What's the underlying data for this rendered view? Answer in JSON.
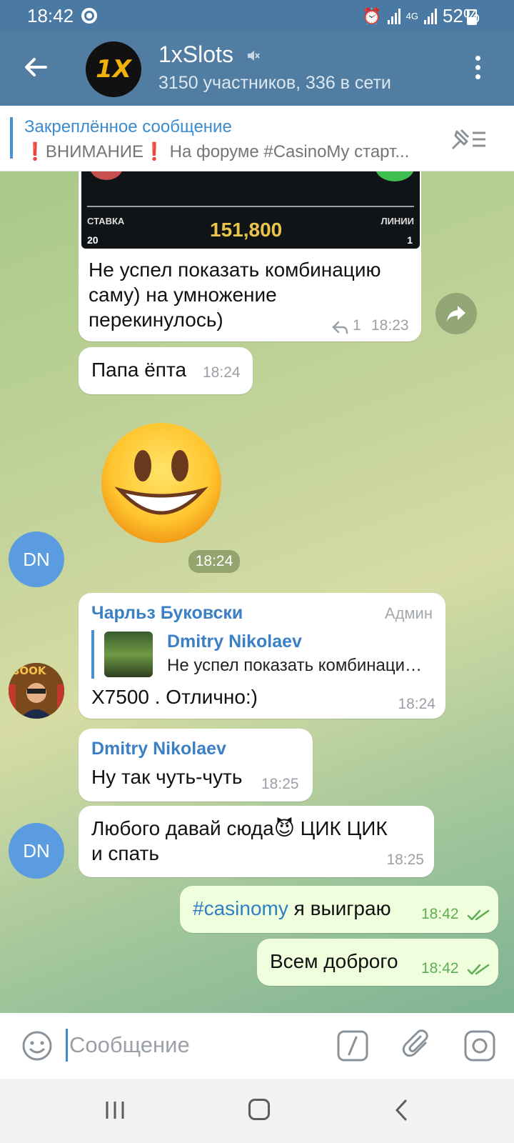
{
  "status_bar": {
    "time": "18:42",
    "network": "4G",
    "battery": "52%"
  },
  "header": {
    "title": "1xSlots",
    "subtitle": "3150 участников, 336 в сети",
    "logo_text": "1X"
  },
  "pinned": {
    "title": "Закреплённое сообщение",
    "text": "❗ВНИМАНИЕ❗ На форуме #CasinoMy старт..."
  },
  "messages": {
    "m1": {
      "image": {
        "stake_label": "СТАВКА",
        "stake_value": "20",
        "win": "151,800",
        "lines_label": "ЛИНИИ",
        "lines_value": "1"
      },
      "text_line1": "Не успел показать комбинацию",
      "text_line2": "саму) на умножение",
      "text_line3": "перекинулось)",
      "replies": "1",
      "time": "18:23"
    },
    "m2": {
      "text": "Папа ёпта",
      "time": "18:24"
    },
    "m3": {
      "emoji": "😃",
      "time": "18:24",
      "avatar": "DN"
    },
    "m4": {
      "sender": "Чарльз Буковски",
      "badge": "Админ",
      "reply_name": "Dmitry Nikolaev",
      "reply_text": "Не успел показать комбинацию саму) на умножение перекинулось)",
      "text": "Х7500 . Отлично:)",
      "time": "18:24"
    },
    "m5": {
      "sender": "Dmitry Nikolaev",
      "text": "Ну так чуть-чуть",
      "time": "18:25"
    },
    "m6": {
      "text_line1": "Любого давай сюда😈 ЦИК ЦИК",
      "text_line2": "и спать",
      "time": "18:25",
      "avatar": "DN"
    },
    "m7": {
      "hashtag": "#casinomy",
      "text": " я выиграю",
      "time": "18:42"
    },
    "m8": {
      "text": "Всем доброго",
      "time": "18:42"
    }
  },
  "input": {
    "placeholder": "Сообщение"
  },
  "icons": {
    "back": "arrow-left-icon",
    "mute": "muted-speaker-icon",
    "menu": "more-vertical-icon",
    "pin_list": "pin-list-icon",
    "forward": "forward-icon",
    "reply": "reply-icon",
    "check": "double-check-icon",
    "emoji": "emoji-icon",
    "commands": "bot-command-icon",
    "attach": "paperclip-icon",
    "camera": "instagram-camera-icon"
  },
  "colors": {
    "header": "#517da2",
    "status_bar": "#4a7aa3",
    "link": "#3a8ccf",
    "outgoing_bubble": "#effedd",
    "check": "#5dae52",
    "avatar_dn": "#5b9be0"
  }
}
